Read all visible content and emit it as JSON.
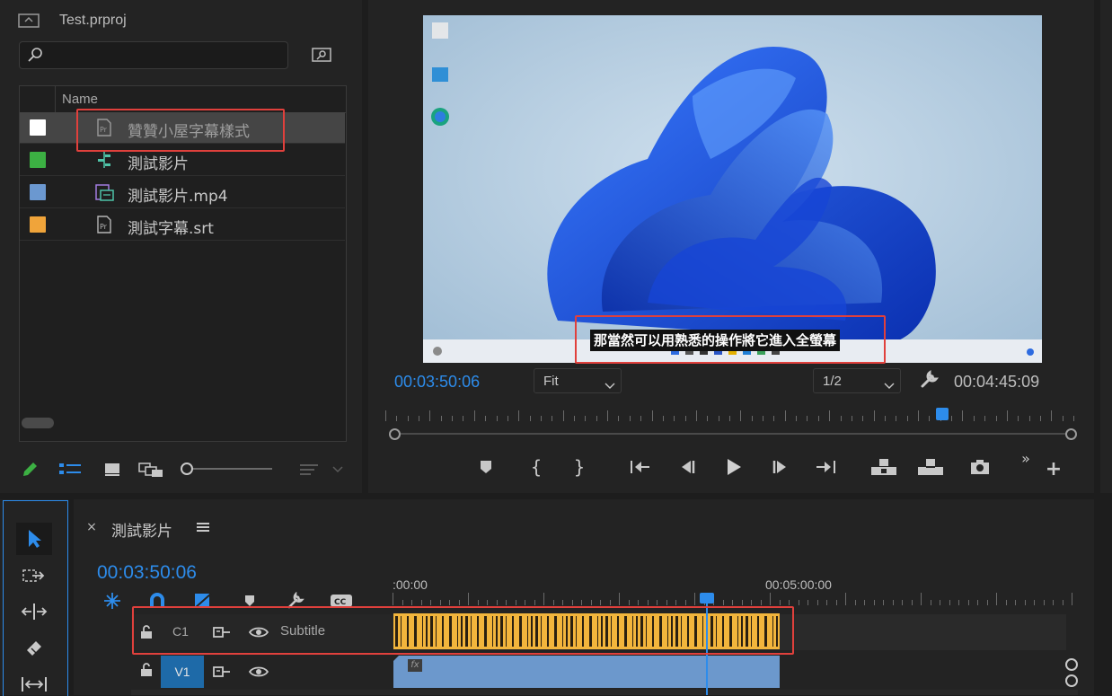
{
  "project": {
    "title": "Test.prproj",
    "column_name": "Name",
    "items": [
      {
        "label": "贊贊小屋字幕樣式",
        "color": "#ffffff",
        "icon": "pr-file-icon"
      },
      {
        "label": "測試影片",
        "color": "#3cb043",
        "icon": "sequence-icon"
      },
      {
        "label": "測試影片.mp4",
        "color": "#6b98d0",
        "icon": "video-file-icon"
      },
      {
        "label": "測試字幕.srt",
        "color": "#f0a43a",
        "icon": "pr-file-icon"
      }
    ]
  },
  "monitor": {
    "timecode_current": "00:03:50:06",
    "fit_label": "Fit",
    "resolution_label": "1/2",
    "timecode_duration": "00:04:45:09",
    "subtitle_text": "那當然可以用熟悉的操作將它進入全螢幕",
    "playhead_fraction": 0.81
  },
  "timeline": {
    "sequence_name": "測試影片",
    "timecode": "00:03:50:06",
    "ruler_start": ":00:00",
    "ruler_mark": "00:05:00:00",
    "tracks": [
      {
        "id": "C1",
        "name": "Subtitle"
      },
      {
        "id": "V1",
        "name": ""
      }
    ]
  },
  "colors": {
    "accent_blue": "#2d8ceb",
    "highlight_red": "#e0403c",
    "caption_yellow": "#f2b53c",
    "clip_blue": "#6c98cc"
  }
}
